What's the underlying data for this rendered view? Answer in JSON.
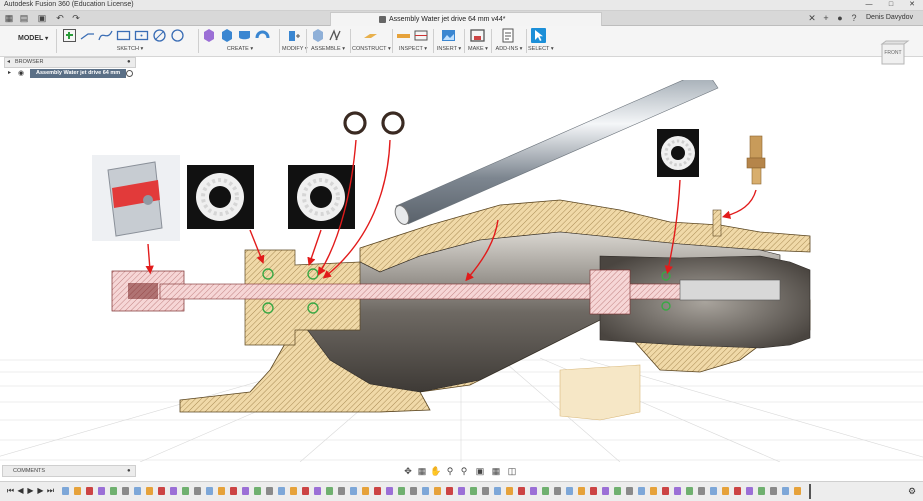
{
  "app": {
    "title": "Autodesk Fusion 360 (Education License)"
  },
  "window_controls": [
    {
      "name": "minimize",
      "glyph": "—"
    },
    {
      "name": "maximize",
      "glyph": "□"
    },
    {
      "name": "close",
      "glyph": "✕"
    }
  ],
  "document": {
    "tab_title": "Assembly Water jet drive 64 mm v44*"
  },
  "user": {
    "name": "Denis Davydov"
  },
  "toolbar": {
    "workspace": "MODEL",
    "groups": [
      {
        "label": "SKETCH",
        "icons": 7
      },
      {
        "label": "CREATE",
        "icons": 5
      },
      {
        "label": "MODIFY",
        "icons": 1
      },
      {
        "label": "ASSEMBLE",
        "icons": 2
      },
      {
        "label": "CONSTRUCT",
        "icons": 1
      },
      {
        "label": "INSPECT",
        "icons": 2
      },
      {
        "label": "INSERT",
        "icons": 1
      },
      {
        "label": "MAKE",
        "icons": 1
      },
      {
        "label": "ADD-INS",
        "icons": 1
      },
      {
        "label": "SELECT",
        "icons": 1
      }
    ]
  },
  "browser": {
    "title": "BROWSER",
    "root_node": "Assembly Water jet drive 64 mm"
  },
  "viewcube": {
    "face": "FRONT"
  },
  "comments": {
    "title": "COMMENTS"
  },
  "colors": {
    "accent": "#0696d7",
    "section_hatch": "#e9c98f",
    "shaft_section": "#f3c9c9",
    "annotation_arrow": "#e21b1b",
    "bearing_ring": "#3aa845"
  }
}
